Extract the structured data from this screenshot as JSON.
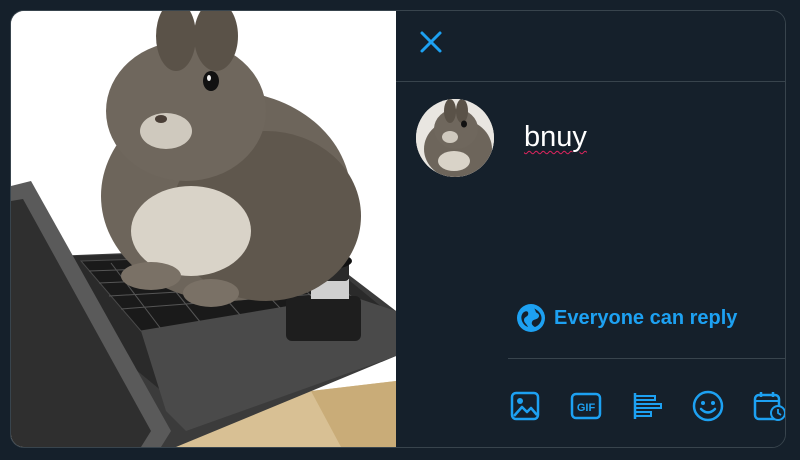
{
  "compose": {
    "tweet_text": "bnuy",
    "reply_setting": "Everyone can reply",
    "accent_color": "#1da1f2",
    "spellcheck_color": "#e0245e"
  },
  "toolbar": {
    "icons": [
      "image-icon",
      "gif-icon",
      "poll-icon",
      "emoji-icon",
      "schedule-icon"
    ],
    "gif_label": "GIF"
  },
  "media": {
    "description_icon": "rabbit-on-laptop-photo"
  },
  "colors": {
    "background": "#15202b",
    "border": "#38444d",
    "text": "#ffffff"
  }
}
